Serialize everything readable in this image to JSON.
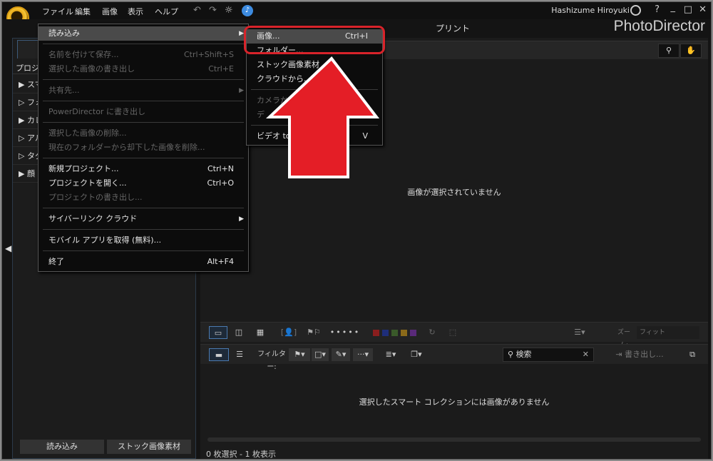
{
  "menubar": {
    "items": [
      "ファイル",
      "編集",
      "画像",
      "表示",
      "ヘルプ"
    ]
  },
  "user": {
    "name": "Hashizume Hiroyuki"
  },
  "window_controls": {
    "help": "?",
    "minimize": "_",
    "maximize": "□",
    "close": "✕"
  },
  "tabs": {
    "print": "プリント"
  },
  "brand": "PhotoDirector",
  "left_panel": {
    "header": "プロジェ",
    "items": [
      {
        "arrow": "▶",
        "label": "スマ"
      },
      {
        "arrow": "▷",
        "label": "フォ"
      },
      {
        "arrow": "▶",
        "label": "カレ"
      },
      {
        "arrow": "▷",
        "label": "アル"
      },
      {
        "arrow": "▷",
        "label": "タグ"
      },
      {
        "arrow": "▶",
        "label": "顔"
      }
    ],
    "import_button": "読み込み",
    "stock_button": "ストック画像素材"
  },
  "viewer": {
    "empty_text": "画像が選択されていません"
  },
  "toolbar1": {
    "zoom_label": "ズーム:",
    "zoom_value": "フィット",
    "colors": [
      "#8a1e1e",
      "#1e2e7a",
      "#3a5a2a",
      "#8a6a1a",
      "#5a2a7a"
    ]
  },
  "toolbar2": {
    "filter_label": "フィルター:",
    "search_placeholder": "検索",
    "export_label": "書き出し..."
  },
  "browser": {
    "empty_text": "選択したスマート コレクションには画像がありません"
  },
  "status": "0 枚選択 - 1 枚表示",
  "file_menu": {
    "items": [
      {
        "label": "読み込み",
        "shortcut": "",
        "submenu": true,
        "disabled": false,
        "highlight": true
      },
      {
        "sep": true
      },
      {
        "label": "名前を付けて保存...",
        "shortcut": "Ctrl+Shift+S",
        "disabled": true
      },
      {
        "label": "選択した画像の書き出し",
        "shortcut": "Ctrl+E",
        "disabled": true
      },
      {
        "sep": true
      },
      {
        "label": "共有先...",
        "shortcut": "",
        "submenu": true,
        "disabled": true
      },
      {
        "sep": true
      },
      {
        "label": "PowerDirector に書き出し",
        "shortcut": "",
        "disabled": true
      },
      {
        "sep": true
      },
      {
        "label": "選択した画像の削除...",
        "shortcut": "",
        "disabled": true
      },
      {
        "label": "現在のフォルダーから却下した画像を削除...",
        "shortcut": "",
        "disabled": true
      },
      {
        "sep": true
      },
      {
        "label": "新規プロジェクト...",
        "shortcut": "Ctrl+N",
        "disabled": false
      },
      {
        "label": "プロジェクトを開く...",
        "shortcut": "Ctrl+O",
        "disabled": false
      },
      {
        "label": "プロジェクトの書き出し...",
        "shortcut": "",
        "disabled": true
      },
      {
        "sep": true
      },
      {
        "label": "サイバーリンク クラウド",
        "shortcut": "",
        "submenu": true,
        "disabled": false
      },
      {
        "sep": true
      },
      {
        "label": "モバイル アプリを取得 (無料)...",
        "shortcut": "",
        "disabled": false
      },
      {
        "sep": true
      },
      {
        "label": "終了",
        "shortcut": "Alt+F4",
        "disabled": false
      }
    ]
  },
  "import_submenu": {
    "items": [
      {
        "label": "画像...",
        "shortcut": "Ctrl+I",
        "disabled": false,
        "highlight": true
      },
      {
        "label": "フォルダー...",
        "shortcut": "",
        "disabled": false
      },
      {
        "label": "ストック画像素材",
        "shortcut": "",
        "disabled": false
      },
      {
        "label": "クラウドから...",
        "shortcut": "",
        "disabled": false
      },
      {
        "sep": true
      },
      {
        "label": "カメラから",
        "shortcut": "",
        "disabled": true
      },
      {
        "label": "デ",
        "shortcut": "",
        "disabled": true
      },
      {
        "sep": true
      },
      {
        "label": "ビデオ to フ",
        "shortcut": "V",
        "disabled": false
      }
    ]
  },
  "annotation": {
    "color": "#e02028"
  }
}
